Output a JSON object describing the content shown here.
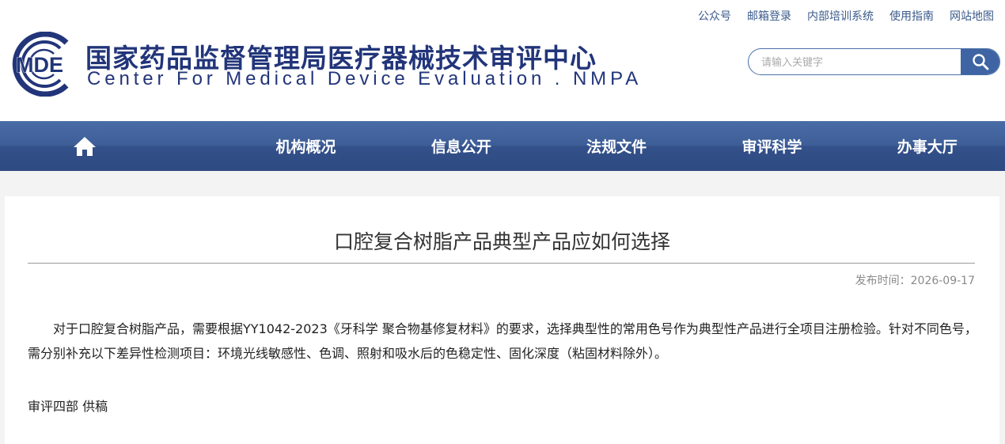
{
  "top_links": [
    "公众号",
    "邮箱登录",
    "内部培训系统",
    "使用指南",
    "网站地图"
  ],
  "header": {
    "logo_text": "MDE",
    "title": "国家药品监督管理局医疗器械技术审评中心",
    "subtitle": "Center For Medical Device Evaluation . NMPA"
  },
  "search": {
    "placeholder": "请输入关键字",
    "value": ""
  },
  "nav": {
    "home_icon": "home-icon",
    "items": [
      "机构概况",
      "信息公开",
      "法规文件",
      "审评科学",
      "办事大厅"
    ]
  },
  "article": {
    "title": "口腔复合树脂产品典型产品应如何选择",
    "publish_label": "发布时间：",
    "publish_date": "2026-09-17",
    "body": "对于口腔复合树脂产品，需要根据YY1042-2023《牙科学 聚合物基修复材料》的要求，选择典型性的常用色号作为典型性产品进行全项目注册检验。针对不同色号，需分别补充以下差异性检测项目：环境光线敏感性、色调、照射和吸水后的色稳定性、固化深度（粘固材料除外）。",
    "author": "审评四部 供稿"
  },
  "colors": {
    "brand": "#22357a",
    "nav": "#3e5e98",
    "search_button": "#3f64a3",
    "link": "#3a5a8c"
  }
}
